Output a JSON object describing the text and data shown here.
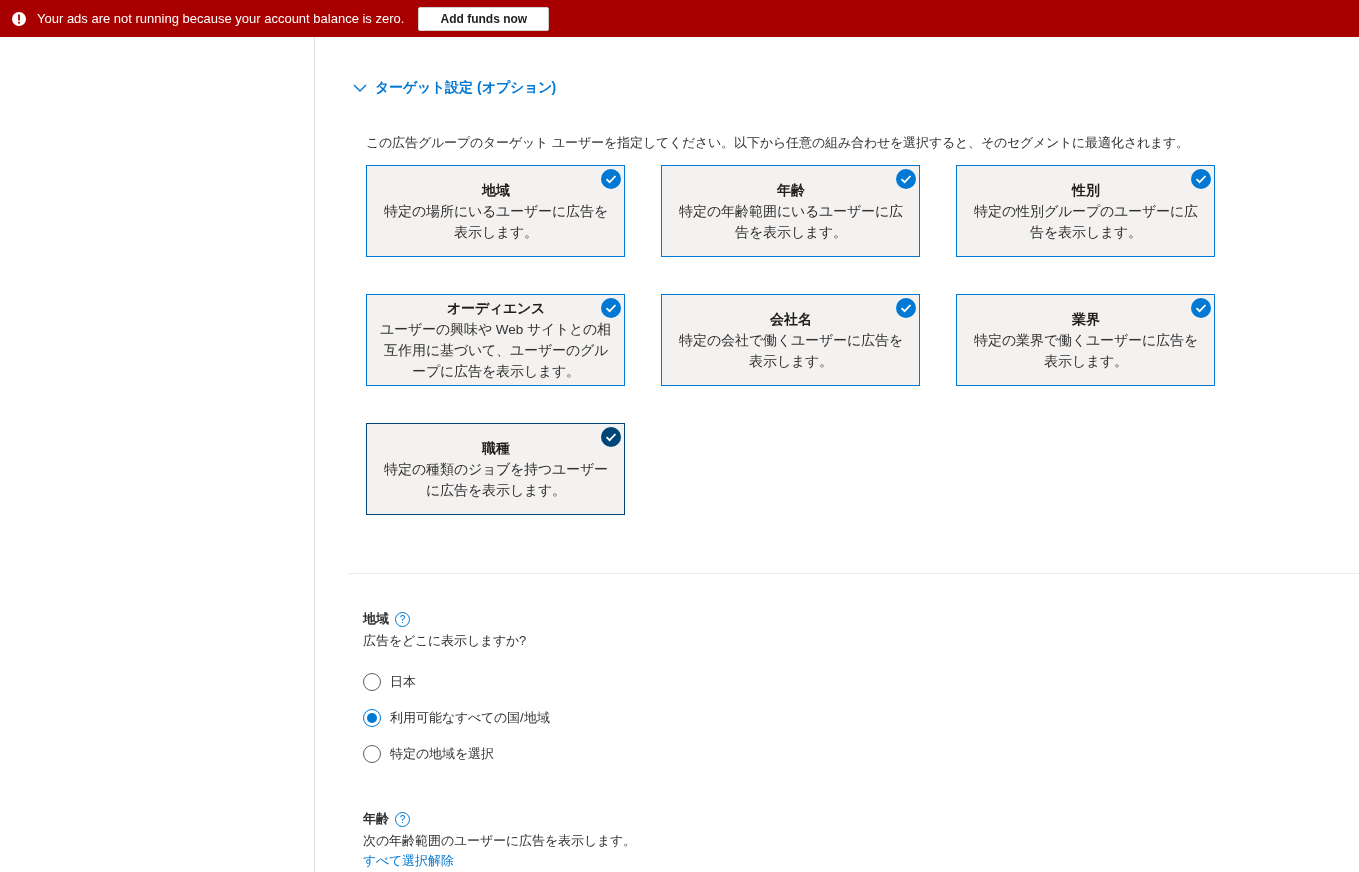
{
  "banner": {
    "message": "Your ads are not running because your account balance is zero.",
    "button": "Add funds now"
  },
  "targeting": {
    "title": "ターゲット設定 (オプション)",
    "expanded": true,
    "description": "この広告グループのターゲット ユーザーを指定してください。以下から任意の組み合わせを選択すると、そのセグメントに最適化されます。",
    "cards": [
      {
        "title": "地域",
        "text": "特定の場所にいるユーザーに広告を表示します。",
        "selected": true,
        "focused": false
      },
      {
        "title": "年齢",
        "text": "特定の年齢範囲にいるユーザーに広告を表示します。",
        "selected": true,
        "focused": false
      },
      {
        "title": "性別",
        "text": "特定の性別グループのユーザーに広告を表示します。",
        "selected": true,
        "focused": false
      },
      {
        "title": "オーディエンス",
        "text": "ユーザーの興味や Web サイトとの相互作用に基づいて、ユーザーのグループに広告を表示します。",
        "selected": true,
        "focused": false
      },
      {
        "title": "会社名",
        "text": "特定の会社で働くユーザーに広告を表示します。",
        "selected": true,
        "focused": false
      },
      {
        "title": "業界",
        "text": "特定の業界で働くユーザーに広告を表示します。",
        "selected": true,
        "focused": false
      },
      {
        "title": "職種",
        "text": "特定の種類のジョブを持つユーザーに広告を表示します。",
        "selected": true,
        "focused": true
      }
    ]
  },
  "location": {
    "label": "地域",
    "help": "?",
    "question": "広告をどこに表示しますか?",
    "options": [
      {
        "label": "日本",
        "selected": false
      },
      {
        "label": "利用可能なすべての国/地域",
        "selected": true
      },
      {
        "label": "特定の地域を選択",
        "selected": false
      }
    ]
  },
  "age": {
    "label": "年齢",
    "help": "?",
    "description": "次の年齢範囲のユーザーに広告を表示します。",
    "link": "すべて選択解除"
  }
}
